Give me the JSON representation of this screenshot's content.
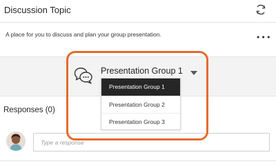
{
  "header": {
    "title": "Discussion Topic",
    "refresh_icon": "refresh-icon"
  },
  "topic": {
    "description": "A place for you to discuss and plan your group presentation.",
    "more_icon": "more-icon"
  },
  "group_selector": {
    "icon": "chat-bubbles-icon",
    "selected": "Presentation Group 1",
    "options": [
      "Presentation Group 1",
      "Presentation Group 2",
      "Presentation Group 3"
    ]
  },
  "responses": {
    "heading": "Responses (0)",
    "input_placeholder": "Type a response",
    "input_value": ""
  },
  "colors": {
    "highlight": "#e46b2c",
    "selected_option_bg": "#262626",
    "band_bg": "#f3f3f3"
  }
}
